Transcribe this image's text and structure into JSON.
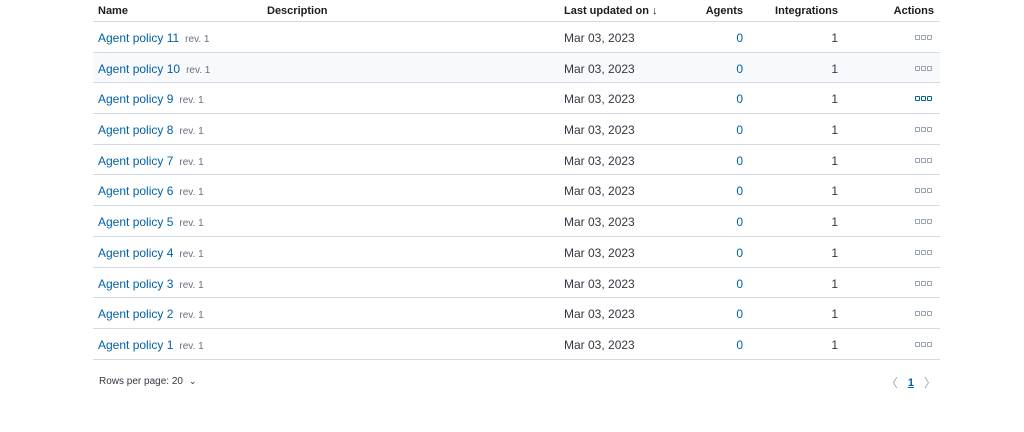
{
  "table": {
    "headers": {
      "name": "Name",
      "description": "Description",
      "last_updated": "Last updated on",
      "agents": "Agents",
      "integrations": "Integrations",
      "actions": "Actions"
    },
    "rows": [
      {
        "name": "Agent policy 11",
        "rev": "rev. 1",
        "description": "",
        "updated": "Mar 03, 2023",
        "agents": "0",
        "integrations": "1"
      },
      {
        "name": "Agent policy 10",
        "rev": "rev. 1",
        "description": "",
        "updated": "Mar 03, 2023",
        "agents": "0",
        "integrations": "1"
      },
      {
        "name": "Agent policy 9",
        "rev": "rev. 1",
        "description": "",
        "updated": "Mar 03, 2023",
        "agents": "0",
        "integrations": "1"
      },
      {
        "name": "Agent policy 8",
        "rev": "rev. 1",
        "description": "",
        "updated": "Mar 03, 2023",
        "agents": "0",
        "integrations": "1"
      },
      {
        "name": "Agent policy 7",
        "rev": "rev. 1",
        "description": "",
        "updated": "Mar 03, 2023",
        "agents": "0",
        "integrations": "1"
      },
      {
        "name": "Agent policy 6",
        "rev": "rev. 1",
        "description": "",
        "updated": "Mar 03, 2023",
        "agents": "0",
        "integrations": "1"
      },
      {
        "name": "Agent policy 5",
        "rev": "rev. 1",
        "description": "",
        "updated": "Mar 03, 2023",
        "agents": "0",
        "integrations": "1"
      },
      {
        "name": "Agent policy 4",
        "rev": "rev. 1",
        "description": "",
        "updated": "Mar 03, 2023",
        "agents": "0",
        "integrations": "1"
      },
      {
        "name": "Agent policy 3",
        "rev": "rev. 1",
        "description": "",
        "updated": "Mar 03, 2023",
        "agents": "0",
        "integrations": "1"
      },
      {
        "name": "Agent policy 2",
        "rev": "rev. 1",
        "description": "",
        "updated": "Mar 03, 2023",
        "agents": "0",
        "integrations": "1"
      },
      {
        "name": "Agent policy 1",
        "rev": "rev. 1",
        "description": "",
        "updated": "Mar 03, 2023",
        "agents": "0",
        "integrations": "1"
      }
    ]
  },
  "footer": {
    "rows_per_page": "Rows per page: 20",
    "current_page": "1"
  },
  "colors": {
    "link": "#0061a6",
    "border": "#d3dae6"
  }
}
